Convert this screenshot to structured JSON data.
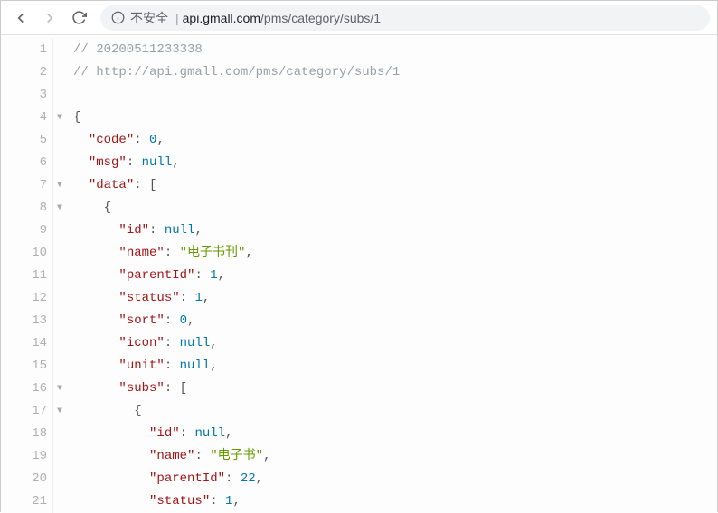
{
  "toolbar": {
    "security_label": "不安全",
    "url_host": "api.gmall.com",
    "url_path": "/pms/category/subs/1"
  },
  "comments": {
    "timestamp": "20200511233338",
    "url": "http://api.gmall.com/pms/category/subs/1"
  },
  "json": {
    "code": 0,
    "msg": null,
    "data": [
      {
        "id": null,
        "name": "电子书刊",
        "parentId": 1,
        "status": 1,
        "sort": 0,
        "icon": null,
        "unit": null,
        "subs": [
          {
            "id": null,
            "name": "电子书",
            "parentId": 22,
            "status": 1
          }
        ]
      }
    ]
  },
  "line_numbers": [
    1,
    2,
    3,
    4,
    5,
    6,
    7,
    8,
    9,
    10,
    11,
    12,
    13,
    14,
    15,
    16,
    17,
    18,
    19,
    20,
    21
  ],
  "fold_markers": {
    "4": "▼",
    "7": "▼",
    "8": "▼",
    "16": "▼",
    "17": "▼"
  }
}
